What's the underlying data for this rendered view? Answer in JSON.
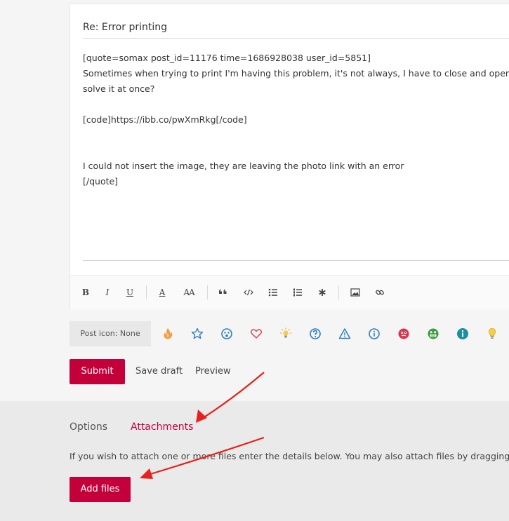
{
  "editor": {
    "subject": "Re: Error printing",
    "message_lines": [
      "[quote=somax post_id=11176 time=1686928038 user_id=5851]",
      "Sometimes when trying to print I'm having this problem, it's not always, I have to close and open the",
      "solve it at once?",
      "",
      "[code]https://ibb.co/pwXmRkg[/code]",
      "",
      "",
      "I could not insert the image, they are leaving the photo link with an error",
      "[/quote]"
    ],
    "toolbar": {
      "bold": "B",
      "italic": "I",
      "underline": "U",
      "font_color": "A",
      "font_size": "AA"
    }
  },
  "post_icons": {
    "label": "Post icon: None",
    "icons": [
      "fire-icon",
      "star-icon",
      "surprised-face-icon",
      "heart-icon",
      "lightbulb-sun-icon",
      "question-icon",
      "warning-icon",
      "info-circle-icon",
      "red-face-icon",
      "green-face-icon",
      "info-filled-icon",
      "lightbulb-icon"
    ]
  },
  "actions": {
    "submit": "Submit",
    "save_draft": "Save draft",
    "preview": "Preview"
  },
  "tabs": {
    "options": "Options",
    "attachments": "Attachments"
  },
  "attachments": {
    "info": "If you wish to attach one or more files enter the details below. You may also attach files by dragging and",
    "add_files": "Add files"
  },
  "colors": {
    "accent": "#c4003b",
    "annotation_arrow": "#e8211c"
  }
}
